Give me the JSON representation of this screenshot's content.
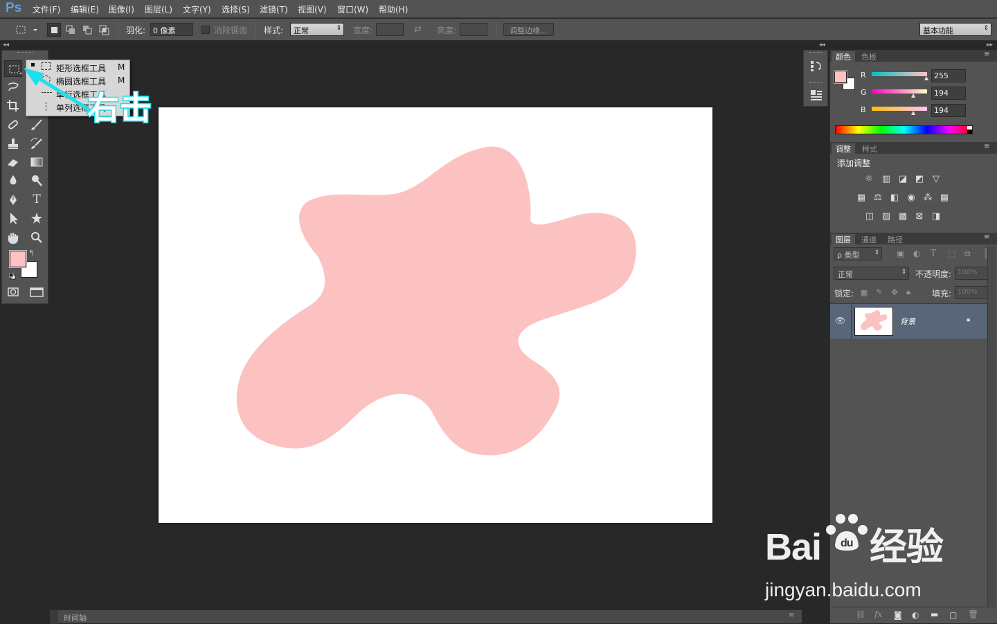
{
  "app": {
    "logo": "Ps"
  },
  "menubar": {
    "items": [
      "文件(F)",
      "编辑(E)",
      "图像(I)",
      "图层(L)",
      "文字(Y)",
      "选择(S)",
      "滤镜(T)",
      "视图(V)",
      "窗口(W)",
      "帮助(H)"
    ]
  },
  "options": {
    "feather_label": "羽化:",
    "feather_value": "0 像素",
    "antialias_label": "消除锯齿",
    "style_label": "样式:",
    "style_value": "正常",
    "width_label": "宽度:",
    "height_label": "高度:",
    "refine_edge": "调整边缘...",
    "workspace": "基本功能"
  },
  "flyout": {
    "items": [
      {
        "label": "矩形选框工具",
        "shortcut": "M",
        "active": true
      },
      {
        "label": "椭圆选框工具",
        "shortcut": "M"
      },
      {
        "label": "单行选框工具",
        "shortcut": ""
      },
      {
        "label": "单列选框工具",
        "shortcut": ""
      }
    ]
  },
  "annotation": {
    "text": "右击",
    "color": "#29e6f0"
  },
  "colors": {
    "foreground": "#ffc2c2",
    "background": "#ffffff",
    "shape": "#fcc2c2",
    "accent": "#1ee0ec"
  },
  "color_panel": {
    "tabs": [
      "颜色",
      "色板"
    ],
    "r_label": "R",
    "g_label": "G",
    "b_label": "B",
    "r": "255",
    "g": "194",
    "b": "194"
  },
  "adjust_panel": {
    "tabs": [
      "调整",
      "样式"
    ],
    "title": "添加调整"
  },
  "layers_panel": {
    "tabs": [
      "图层",
      "通道",
      "路径"
    ],
    "filter_label": "ρ 类型",
    "blend_mode": "正常",
    "opacity_label": "不透明度:",
    "opacity_value": "100%",
    "lock_label": "锁定:",
    "fill_label": "填充:",
    "fill_value": "100%",
    "layer_name": "背景"
  },
  "timeline": {
    "label": "时间轴"
  },
  "watermark": {
    "brand": "Bai",
    "brand_suffix": "经验",
    "url": "jingyan.baidu.com"
  }
}
